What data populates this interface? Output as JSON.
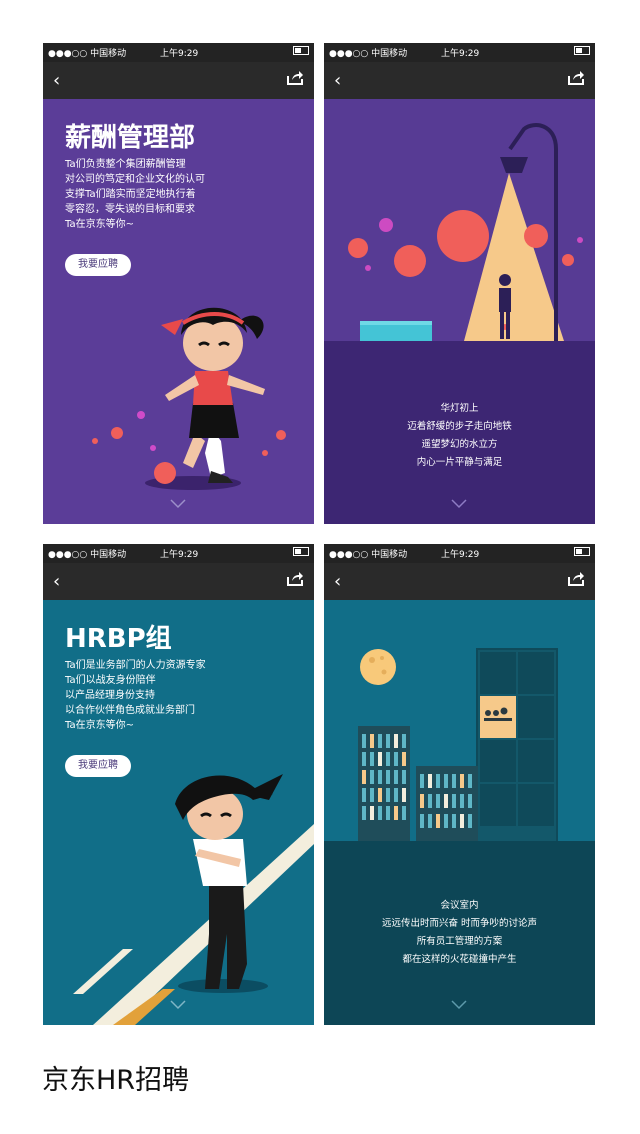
{
  "status": {
    "carrier": "●●●○○ 中国移动",
    "time": "上午9:29"
  },
  "screens": [
    {
      "title": "薪酬管理部",
      "lines": [
        "Ta们负责整个集团薪酬管理",
        "对公司的笃定和企业文化的认可",
        "支撑Ta们踏实而坚定地执行着",
        "零容忍，零失误的目标和要求",
        "Ta在京东等你~"
      ],
      "button": "我要应聘"
    },
    {
      "caption": [
        "华灯初上",
        "迈着舒缓的步子走向地铁",
        "遥望梦幻的水立方",
        "内心一片平静与满足"
      ]
    },
    {
      "title": "HRBP组",
      "lines": [
        "Ta们是业务部门的人力资源专家",
        "Ta们以战友身份陪伴",
        "以产品经理身份支持",
        "以合作伙伴角色成就业务部门",
        "Ta在京东等你~"
      ],
      "button": "我要应聘"
    },
    {
      "caption": [
        "会议室内",
        "远远传出时而兴奋 时而争吵的讨论声",
        "所有员工管理的方案",
        "都在这样的火花碰撞中产生"
      ]
    }
  ],
  "footer": "京东HR招聘",
  "colors": {
    "purple": "#5b3d98",
    "teal": "#116e88",
    "coral": "#f05f5a",
    "lamp": "#f6c98a"
  }
}
